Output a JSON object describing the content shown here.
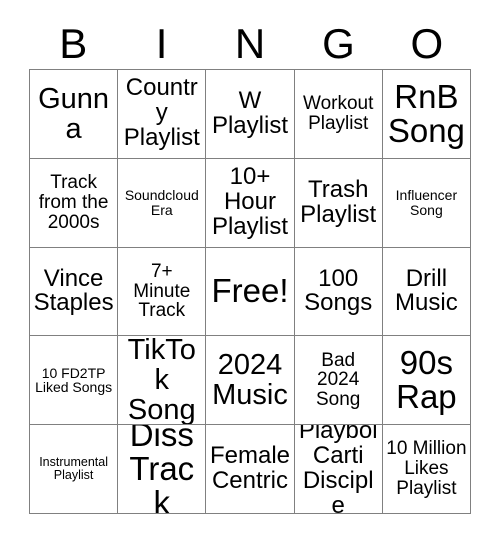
{
  "card": {
    "title": "BINGO",
    "header_letters": [
      "B",
      "I",
      "N",
      "G",
      "O"
    ],
    "grid_size": 5,
    "free_space_label": "Free!",
    "free_space_position": {
      "row": 3,
      "column": 3
    },
    "colors": {
      "background": "#ffffff",
      "text": "#000000",
      "grid_line": "#808080"
    },
    "rows": [
      [
        {
          "text": "Gunna",
          "size": "lg"
        },
        {
          "text": "Country Playlist",
          "size": "md"
        },
        {
          "text": "W Playlist",
          "size": "md"
        },
        {
          "text": "Workout Playlist",
          "size": "sm"
        },
        {
          "text": "RnB Song",
          "size": "xl"
        }
      ],
      [
        {
          "text": "Track from the 2000s",
          "size": "sm"
        },
        {
          "text": "Soundcloud Era",
          "size": "xs"
        },
        {
          "text": "10+ Hour Playlist",
          "size": "md"
        },
        {
          "text": "Trash Playlist",
          "size": "md"
        },
        {
          "text": "Influencer Song",
          "size": "xs"
        }
      ],
      [
        {
          "text": "Vince Staples",
          "size": "md"
        },
        {
          "text": "7+ Minute Track",
          "size": "sm"
        },
        {
          "text": "Free!",
          "size": "xl"
        },
        {
          "text": "100 Songs",
          "size": "md"
        },
        {
          "text": "Drill Music",
          "size": "md"
        }
      ],
      [
        {
          "text": "10 FD2TP Liked Songs",
          "size": "xs"
        },
        {
          "text": "TikTok Song",
          "size": "lg"
        },
        {
          "text": "2024 Music",
          "size": "lg"
        },
        {
          "text": "Bad 2024 Song",
          "size": "sm"
        },
        {
          "text": "90s Rap",
          "size": "xl"
        }
      ],
      [
        {
          "text": "Instrumental Playlist",
          "size": "xxs"
        },
        {
          "text": "Diss Track",
          "size": "xl"
        },
        {
          "text": "Female Centric",
          "size": "md"
        },
        {
          "text": "Playboi Carti Disciple",
          "size": "md"
        },
        {
          "text": "10 Million Likes Playlist",
          "size": "sm"
        }
      ]
    ]
  }
}
